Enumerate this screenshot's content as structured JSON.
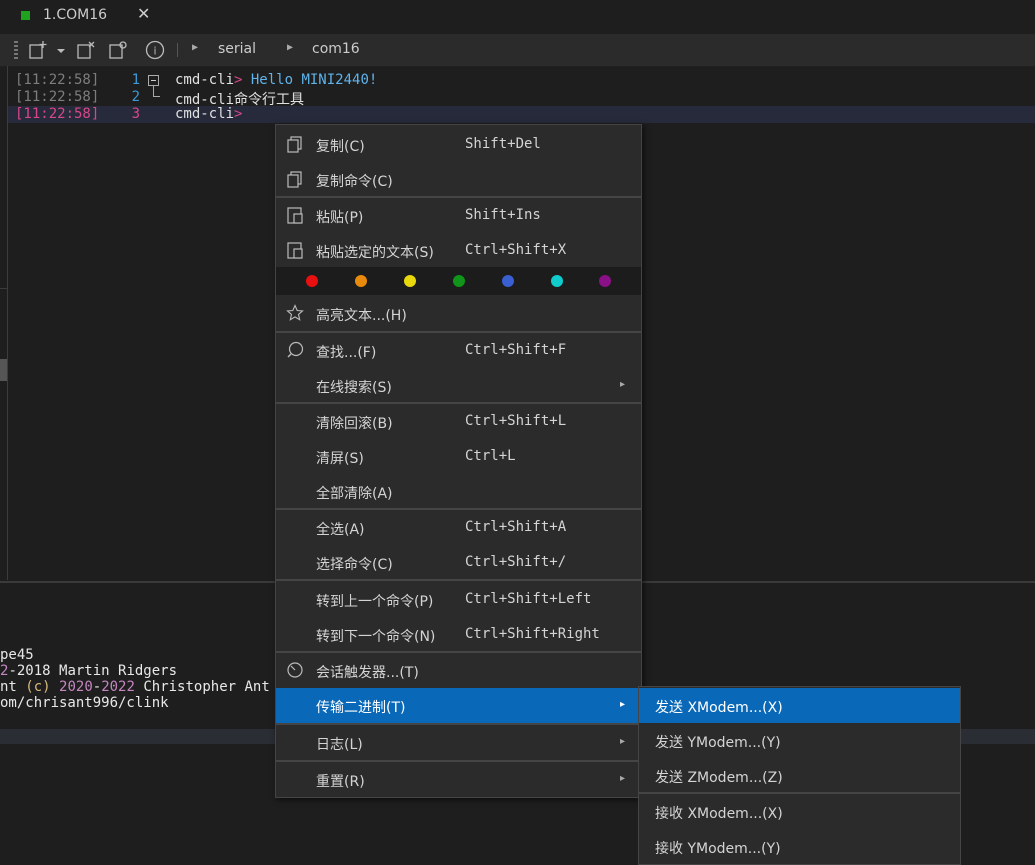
{
  "tab": {
    "title": "1.COM16",
    "close": "✕"
  },
  "toolbar": {
    "info": "i",
    "crumbs": [
      "serial",
      "com16"
    ]
  },
  "terminal": {
    "lines": [
      {
        "ts": "[11:22:58]",
        "num": "1",
        "prompt": "cmd-cli",
        "arrow": ">",
        "text": " Hello MINI2440!"
      },
      {
        "ts": "[11:22:58]",
        "num": "2",
        "prompt": "cmd-cli",
        "text": "命令行工具"
      },
      {
        "ts": "[11:22:58]",
        "num": "3",
        "prompt": "cmd-cli",
        "arrow": ">"
      }
    ]
  },
  "bottom": {
    "l1": "pe45",
    "l2a": "2",
    "l2b": "-2018 Martin Ridgers",
    "l3a": "nt ",
    "l3b": "(c)",
    "l3c": " ",
    "l3d": "2020",
    "l3e": "-",
    "l3f": "2022",
    "l3g": " Christopher Ant",
    "l4": "om/chrisant996/clink"
  },
  "menu": {
    "copy": {
      "label": "复制(C)",
      "shortcut": "Shift+Del"
    },
    "copy_cmd": {
      "label": "复制命令(C)"
    },
    "paste": {
      "label": "粘贴(P)",
      "shortcut": "Shift+Ins"
    },
    "paste_sel": {
      "label": "粘贴选定的文本(S)",
      "shortcut": "Ctrl+Shift+X"
    },
    "colors": [
      "#e81010",
      "#e88a0c",
      "#e8d80c",
      "#10941a",
      "#3a5fd0",
      "#10cccc",
      "#8a1088"
    ],
    "highlight": {
      "label": "高亮文本...(H)"
    },
    "find": {
      "label": "查找...(F)",
      "shortcut": "Ctrl+Shift+F"
    },
    "online": {
      "label": "在线搜索(S)",
      "arrow": "▸"
    },
    "clear_scroll": {
      "label": "清除回滚(B)",
      "shortcut": "Ctrl+Shift+L"
    },
    "clear_screen": {
      "label": "清屏(S)",
      "shortcut": "Ctrl+L"
    },
    "clear_all": {
      "label": "全部清除(A)"
    },
    "select_all": {
      "label": "全选(A)",
      "shortcut": "Ctrl+Shift+A"
    },
    "select_cmd": {
      "label": "选择命令(C)",
      "shortcut": "Ctrl+Shift+/"
    },
    "prev_cmd": {
      "label": "转到上一个命令(P)",
      "shortcut": "Ctrl+Shift+Left"
    },
    "next_cmd": {
      "label": "转到下一个命令(N)",
      "shortcut": "Ctrl+Shift+Right"
    },
    "trigger": {
      "label": "会话触发器...(T)"
    },
    "transfer": {
      "label": "传输二进制(T)",
      "arrow": "▸"
    },
    "log": {
      "label": "日志(L)",
      "arrow": "▸"
    },
    "reset": {
      "label": "重置(R)",
      "arrow": "▸"
    }
  },
  "submenu": {
    "send_x": "发送 XModem...(X)",
    "send_y": "发送 YModem...(Y)",
    "send_z": "发送 ZModem...(Z)",
    "recv_x": "接收 XModem...(X)",
    "recv_y": "接收 YModem...(Y)"
  }
}
